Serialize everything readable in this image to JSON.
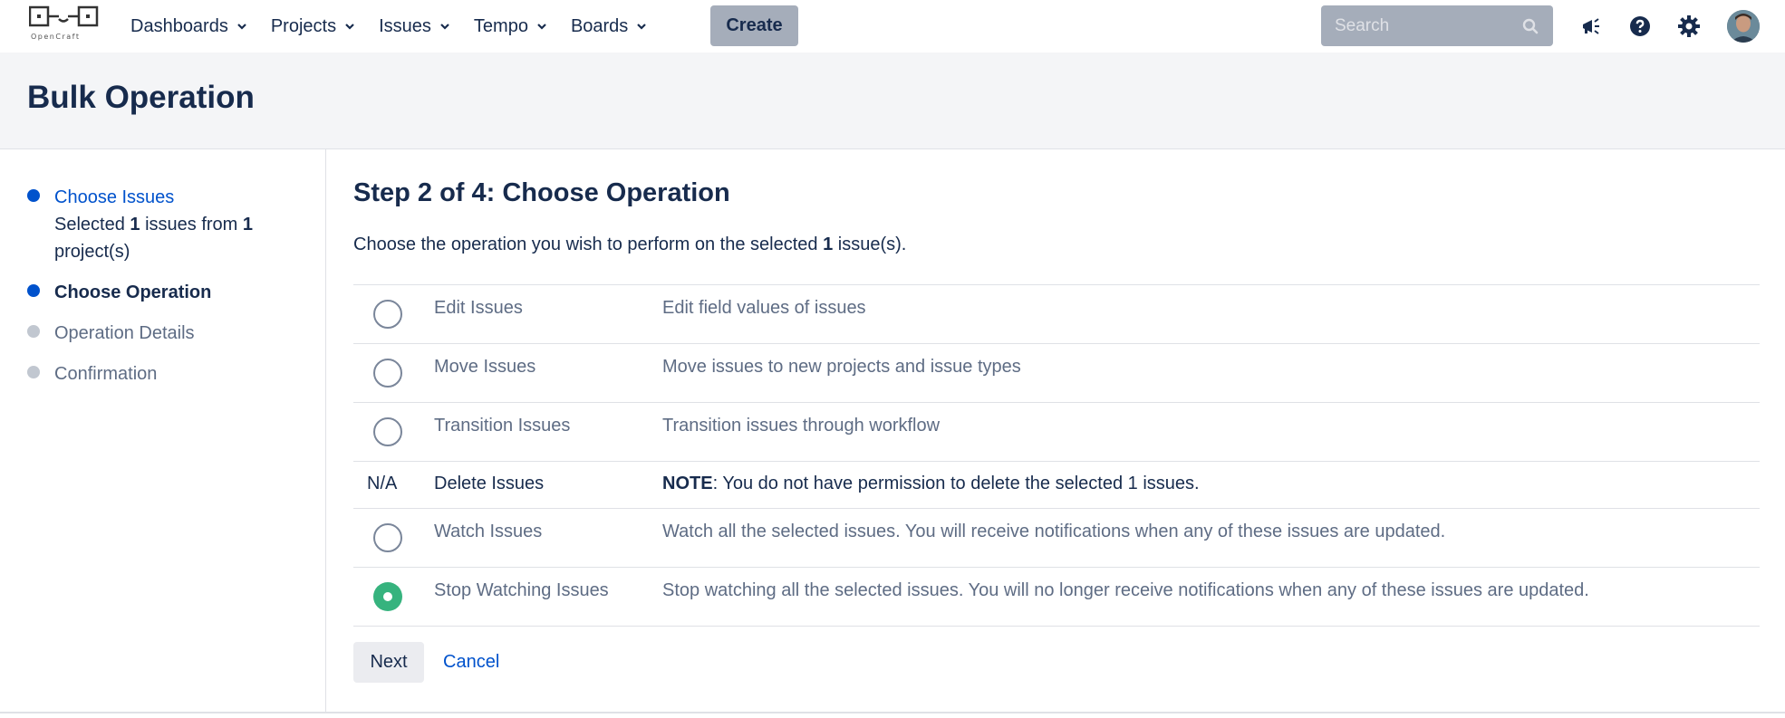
{
  "header": {
    "logo_text": "OpenCraft",
    "nav": [
      {
        "label": "Dashboards"
      },
      {
        "label": "Projects"
      },
      {
        "label": "Issues"
      },
      {
        "label": "Tempo"
      },
      {
        "label": "Boards"
      }
    ],
    "create_label": "Create",
    "search_placeholder": "Search",
    "icons": [
      "megaphone-icon",
      "help-icon",
      "gear-icon",
      "avatar"
    ]
  },
  "page": {
    "title": "Bulk Operation"
  },
  "sidebar": {
    "steps": [
      {
        "label": "Choose Issues",
        "state": "link",
        "sub_prefix": "Selected ",
        "sub_count": "1",
        "sub_mid": " issues from ",
        "sub_projects": "1",
        "sub_suffix": "project(s)"
      },
      {
        "label": "Choose Operation",
        "state": "active"
      },
      {
        "label": "Operation Details",
        "state": "pending"
      },
      {
        "label": "Confirmation",
        "state": "pending"
      }
    ]
  },
  "main": {
    "title": "Step 2 of 4: Choose Operation",
    "desc_prefix": "Choose the operation you wish to perform on the selected ",
    "desc_count": "1",
    "desc_suffix": " issue(s).",
    "operations": [
      {
        "name": "Edit Issues",
        "description": "Edit field values of issues",
        "selected": false
      },
      {
        "name": "Move Issues",
        "description": "Move issues to new projects and issue types",
        "selected": false
      },
      {
        "name": "Transition Issues",
        "description": "Transition issues through workflow",
        "selected": false
      },
      {
        "name": "Delete Issues",
        "na_label": "N/A",
        "note_label": "NOTE",
        "description": ": You do not have permission to delete the selected 1 issues."
      },
      {
        "name": "Watch Issues",
        "description": "Watch all the selected issues. You will receive notifications when any of these issues are updated.",
        "selected": false
      },
      {
        "name": "Stop Watching Issues",
        "description": "Stop watching all the selected issues. You will no longer receive notifications when any of these issues are updated.",
        "selected": true
      }
    ],
    "next_label": "Next",
    "cancel_label": "Cancel"
  },
  "colors": {
    "accent": "#0052cc",
    "selected_radio": "#36b37e",
    "nav_button_bg": "#a5adba"
  }
}
